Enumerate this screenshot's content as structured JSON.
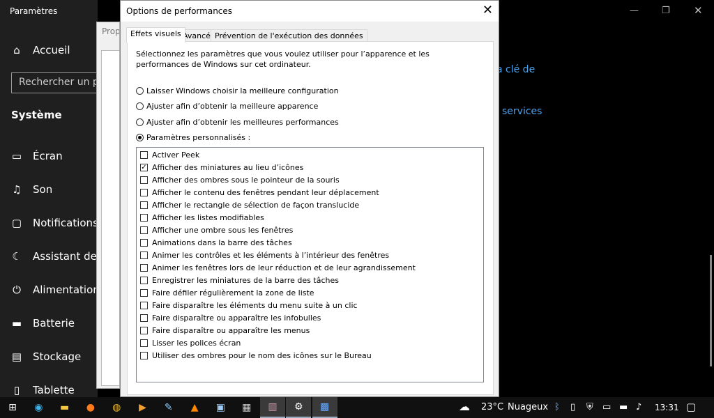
{
  "settings": {
    "title": "Paramètres",
    "home": "Accueil",
    "search_placeholder": "Rechercher un pa",
    "section": "Système",
    "items": [
      {
        "label": "Écran",
        "icon": "monitor-icon"
      },
      {
        "label": "Son",
        "icon": "speaker-icon"
      },
      {
        "label": "Notifications e",
        "icon": "notification-icon"
      },
      {
        "label": "Assistant de c",
        "icon": "moon-icon"
      },
      {
        "label": "Alimentation",
        "icon": "power-icon"
      },
      {
        "label": "Batterie",
        "icon": "battery-icon"
      },
      {
        "label": "Stockage",
        "icon": "storage-icon"
      },
      {
        "label": "Tablette",
        "icon": "tablet-icon"
      }
    ],
    "right_links": [
      "a clé de",
      "services"
    ]
  },
  "props_window": {
    "title": "Prop",
    "tab": "Par"
  },
  "dialog": {
    "title": "Options de performances",
    "tabs": [
      "Effets visuels",
      "Avancé",
      "Prévention de l'exécution des données"
    ],
    "active_tab": 0,
    "description": "Sélectionnez les paramètres que vous voulez utiliser pour l’apparence et les performances de Windows sur cet ordinateur.",
    "radios": [
      {
        "label": "Laisser Windows choisir la meilleure configuration",
        "checked": false
      },
      {
        "label": "Ajuster afin d’obtenir la meilleure apparence",
        "checked": false
      },
      {
        "label": "Ajuster afin d’obtenir les meilleures performances",
        "checked": false
      },
      {
        "label": "Paramètres personnalisés :",
        "checked": true
      }
    ],
    "options": [
      {
        "label": "Activer Peek",
        "checked": false
      },
      {
        "label": "Afficher des miniatures au lieu d’icônes",
        "checked": true
      },
      {
        "label": "Afficher des ombres sous le pointeur de la souris",
        "checked": false
      },
      {
        "label": "Afficher le contenu des fenêtres pendant leur déplacement",
        "checked": false
      },
      {
        "label": "Afficher le rectangle de sélection de façon translucide",
        "checked": false
      },
      {
        "label": "Afficher les listes modifiables",
        "checked": false
      },
      {
        "label": "Afficher une ombre sous les fenêtres",
        "checked": false
      },
      {
        "label": "Animations dans la barre des tâches",
        "checked": false
      },
      {
        "label": "Animer les contrôles et les éléments à l’intérieur des fenêtres",
        "checked": false
      },
      {
        "label": "Animer les fenêtres lors de leur réduction et de leur agrandissement",
        "checked": false
      },
      {
        "label": "Enregistrer les miniatures de la barre des tâches",
        "checked": false
      },
      {
        "label": "Faire défiler régulièrement la zone de liste",
        "checked": false
      },
      {
        "label": "Faire disparaître les éléments du menu suite à un clic",
        "checked": false
      },
      {
        "label": "Faire disparaître ou apparaître les infobulles",
        "checked": false
      },
      {
        "label": "Faire disparaître ou apparaître les menus",
        "checked": false
      },
      {
        "label": "Lisser les polices écran",
        "checked": false
      },
      {
        "label": "Utiliser des ombres pour le nom des icônes sur le Bureau",
        "checked": false
      }
    ]
  },
  "taskbar": {
    "apps": [
      "start-icon",
      "edge-icon",
      "file-explorer-icon",
      "firefox-icon",
      "chrome-icon",
      "media-player-icon",
      "paint-icon",
      "vlc-icon",
      "remote-desktop-icon",
      "calculator-icon",
      "winrar-icon",
      "settings-icon",
      "performance-monitor-icon"
    ],
    "temperature": "23°C",
    "weather": "Nuageux",
    "time": "13:31"
  },
  "colors": {
    "link": "#4aa3f0",
    "sidebar_bg": "#1f1f1f",
    "taskbar_bg": "#101010"
  }
}
